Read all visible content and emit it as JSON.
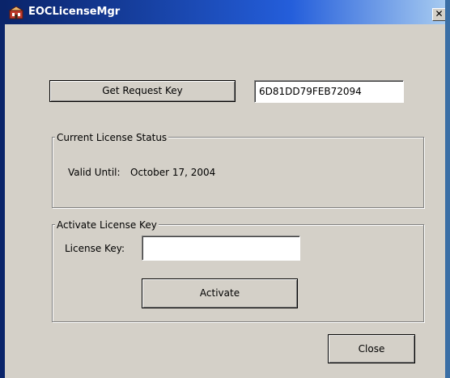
{
  "window": {
    "title": "EOCLicenseMgr",
    "close_glyph": "✕",
    "icon": "license-manager-icon"
  },
  "request": {
    "button_label": "Get Request Key",
    "key_value": "6D81DD79FEB72094"
  },
  "status_group": {
    "legend": "Current License Status",
    "valid_until_label": "Valid Until:",
    "valid_until_date": "October 17, 2004"
  },
  "activate_group": {
    "legend": "Activate License Key",
    "license_key_label": "License Key:",
    "license_key_value": "",
    "activate_button_label": "Activate"
  },
  "footer": {
    "close_button_label": "Close"
  },
  "colors": {
    "titlebar_start": "#0a246a",
    "titlebar_end": "#a6caf0",
    "window_face": "#d4d0c8"
  }
}
